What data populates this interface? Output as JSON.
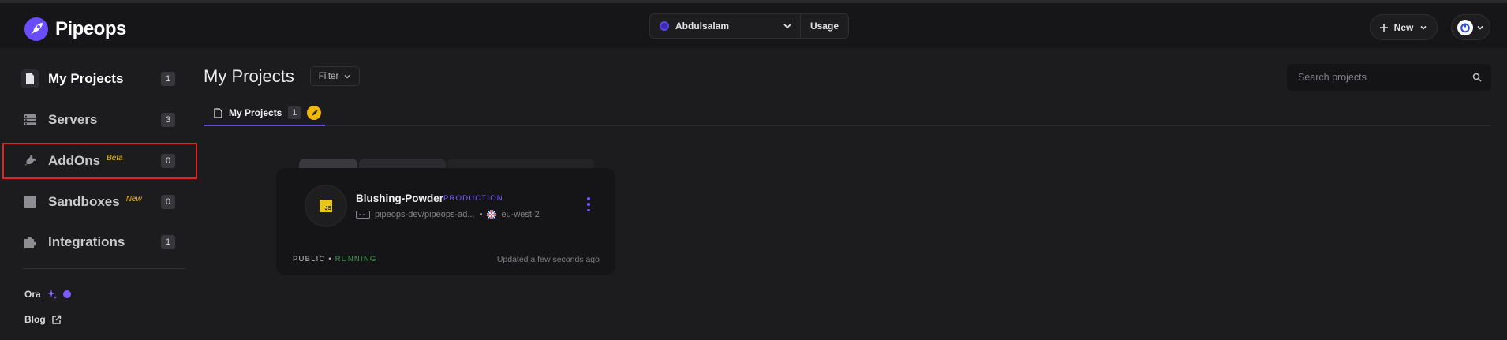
{
  "app": {
    "name": "Pipeops"
  },
  "header": {
    "workspace": "Abdulsalam",
    "usage_label": "Usage",
    "new_label": "New"
  },
  "sidebar": {
    "items": [
      {
        "label": "My Projects",
        "count": "1"
      },
      {
        "label": "Servers",
        "count": "3"
      },
      {
        "label": "AddOns",
        "tag": "Beta",
        "count": "0"
      },
      {
        "label": "Sandboxes",
        "tag": "New",
        "count": "0"
      },
      {
        "label": "Integrations",
        "count": "1"
      }
    ],
    "links": [
      {
        "label": "Ora"
      },
      {
        "label": "Blog"
      }
    ]
  },
  "main": {
    "title": "My Projects",
    "filter_label": "Filter",
    "search_placeholder": "Search projects",
    "tab": {
      "label": "My Projects",
      "count": "1"
    }
  },
  "project": {
    "name": "Blushing-Powder",
    "environment": "PRODUCTION",
    "repo": "pipeops-dev/pipeops-ad...",
    "region": "eu-west-2",
    "visibility": "PUBLIC",
    "status": "RUNNING",
    "updated": "Updated a few seconds ago"
  },
  "colors": {
    "accent": "#5a4bd8",
    "highlight": "#e02424",
    "running": "#3f9e52",
    "tag": "#f2b90c"
  }
}
